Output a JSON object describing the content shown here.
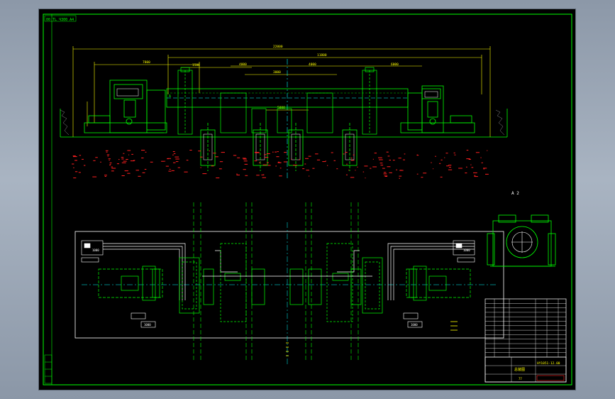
{
  "drawing": {
    "corner_code": "00 ТL ЧЗ00 А4",
    "total_length": "22000",
    "span_main": "11800",
    "span_left_dim": "7800",
    "dim_1500": "1500",
    "dim_4000_a": "4000",
    "dim_4000_b": "4000",
    "dim_6000": "6000",
    "dim_3000": "3000",
    "center_dim": "5000",
    "view_label": "A  2",
    "marker_a": "A",
    "block_left_value": "1000",
    "block_right_value": "1000",
    "small_box_left": "1000",
    "small_box_right": "1000",
    "drawing_number": "HY1051-12.00",
    "title_center": "总装图",
    "scale_note": "77"
  },
  "colors": {
    "background": "#000000",
    "frame": "#00ff00",
    "lines": "#00ff00",
    "dimension": "#ffff00",
    "ground_hatch": "#ff2020",
    "outline": "#ffffff",
    "axis": "#00ffff"
  }
}
